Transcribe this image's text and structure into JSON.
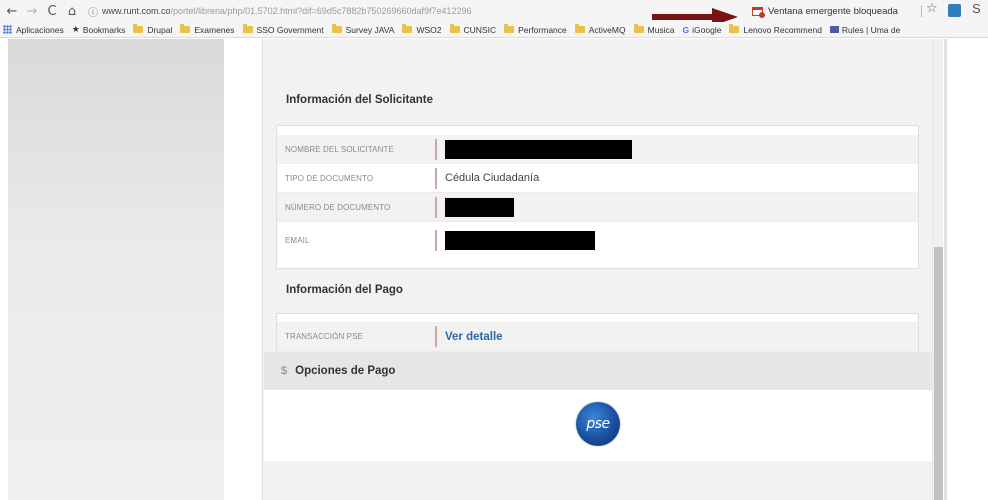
{
  "browser": {
    "url_host": "www.runt.com.co",
    "url_path": "/portel/libreria/php/01.5702.html?dif=69d5c7882b750269660daf9f7e412296",
    "popup_blocked": "Ventana emergente bloqueada",
    "bookmarks": [
      {
        "label": "Aplicaciones",
        "icon": "apps-icon"
      },
      {
        "label": "Bookmarks",
        "icon": "star-icon"
      },
      {
        "label": "Drupal",
        "icon": "folder-icon"
      },
      {
        "label": "Examenes",
        "icon": "folder-icon"
      },
      {
        "label": "SSO Government",
        "icon": "folder-icon"
      },
      {
        "label": "Survey JAVA",
        "icon": "folder-icon"
      },
      {
        "label": "WSO2",
        "icon": "folder-icon"
      },
      {
        "label": "CUNSIC",
        "icon": "folder-icon"
      },
      {
        "label": "Performance",
        "icon": "folder-icon"
      },
      {
        "label": "ActiveMQ",
        "icon": "folder-icon"
      },
      {
        "label": "Musica",
        "icon": "folder-icon"
      },
      {
        "label": "iGoogle",
        "icon": "google-icon"
      },
      {
        "label": "Lenovo Recommend",
        "icon": "folder-icon"
      },
      {
        "label": "Rules | Uma de",
        "icon": "rules-icon"
      }
    ]
  },
  "solicitante": {
    "title": "Información del Solicitante",
    "rows": [
      {
        "label": "NOMBRE DEL SOLICITANTE",
        "value": ""
      },
      {
        "label": "TIPO DE DOCUMENTO",
        "value": "Cédula Ciudadanía"
      },
      {
        "label": "NÚMERO DE DOCUMENTO",
        "value": ""
      },
      {
        "label": "EMAIL",
        "value": ""
      }
    ]
  },
  "pago": {
    "title": "Información del Pago",
    "rows": [
      {
        "label": "TRANSACCIÓN PSE",
        "value": "Ver detalle"
      }
    ]
  },
  "opciones": {
    "symbol": "$",
    "title": "Opciones de Pago",
    "logo_text": "pse"
  },
  "colors": {
    "link": "#2c6aa8",
    "arrow": "#7a1414",
    "pse_blue": "#1a4f9e"
  }
}
